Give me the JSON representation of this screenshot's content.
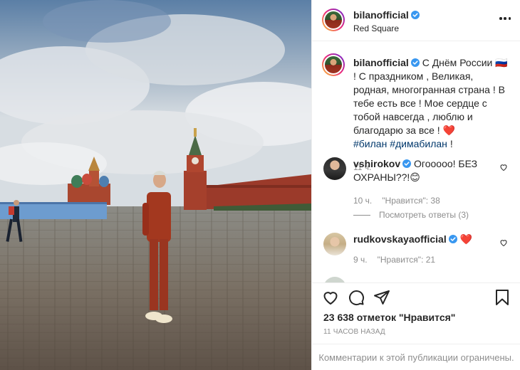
{
  "post": {
    "author": "bilanofficial",
    "location": "Red Square",
    "caption_pre": "С Днём России",
    "flag": "🇷🇺",
    "caption_post": "! С праздником , Великая, родная, многогранная страна ! В тебе есть все ! Мое сердце с тобой навсегда , люблю и благодарю за все !",
    "heart": "❤️",
    "hashtag1": "#билан",
    "hashtag2": "#димабилан",
    "caption_end": "!",
    "caption_time": "11 ч.",
    "likes": "23 638 отметок \"Нравится\"",
    "time_ago": "11 часов назад",
    "restricted_note": "Комментарии к этой публикации ограничены."
  },
  "comments": [
    {
      "username": "vshirokov",
      "text": "Огооооо! БЕЗ ОХРАНЫ??!😊",
      "time": "10 ч.",
      "likes": "\"Нравится\": 38",
      "replies": "Посмотреть ответы (3)"
    },
    {
      "username": "rudkovskayaofficial",
      "text": "❤️",
      "time": "9 ч.",
      "likes": "\"Нравится\": 21"
    }
  ],
  "colors": {
    "verified": "#3897f0",
    "link": "#00376b",
    "muted": "#8e8e8e",
    "text": "#262626"
  },
  "icons": [
    "more-icon",
    "verified-icon",
    "heart-icon",
    "comment-icon",
    "share-icon",
    "bookmark-icon"
  ]
}
